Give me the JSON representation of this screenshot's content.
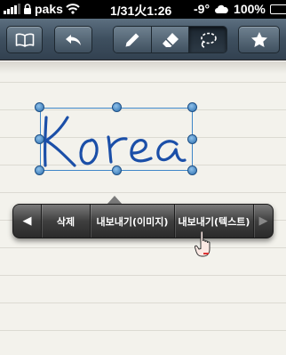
{
  "status_bar": {
    "carrier": "paks",
    "time": "1/31火1:26",
    "temperature": "-9°",
    "battery_percent": "100%",
    "battery_level": 1.0,
    "signal_bars": 4,
    "icons": [
      "lock-icon",
      "wifi-icon",
      "cloud-icon"
    ]
  },
  "toolbar": {
    "buttons": [
      "notebook-icon",
      "undo-icon",
      "pen-icon",
      "eraser-icon",
      "lasso-icon",
      "star-icon"
    ],
    "active_tool": "lasso-icon"
  },
  "canvas": {
    "handwriting": "Korea",
    "ink_color": "#1b4fa8",
    "selection_color": "#3e86c8"
  },
  "popup_menu": {
    "prev_arrow": "◀",
    "items": [
      "삭제",
      "내보내기(이미지)",
      "내보내기(텍스트)"
    ],
    "next_arrow": "▶"
  }
}
